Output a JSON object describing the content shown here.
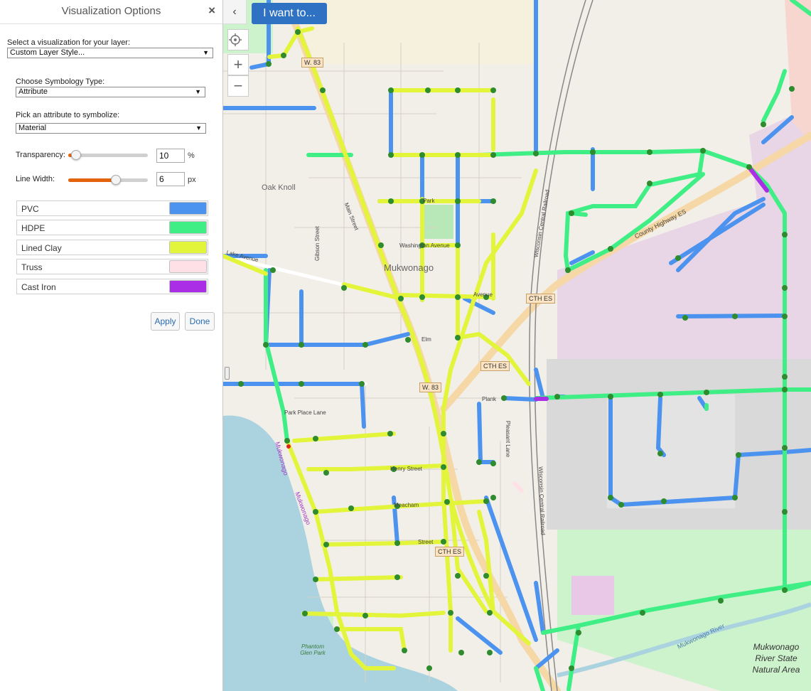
{
  "panel": {
    "title": "Visualization Options",
    "close_symbol": "×",
    "visualization_label": "Select a visualization for your layer:",
    "visualization_value": "Custom Layer Style...",
    "symbology_label": "Choose Symbology Type:",
    "symbology_value": "Attribute",
    "attribute_label": "Pick an attribute to symbolize:",
    "attribute_value": "Material",
    "transparency": {
      "label": "Transparency:",
      "value": "10",
      "unit": "%",
      "fraction": 0.1
    },
    "line_width": {
      "label": "Line Width:",
      "value": "6",
      "unit": "px",
      "fraction": 0.6
    },
    "legend": [
      {
        "label": "PVC",
        "color": "#4b93ee"
      },
      {
        "label": "HDPE",
        "color": "#3fee84"
      },
      {
        "label": "Lined Clay",
        "color": "#e3f53a"
      },
      {
        "label": "Truss",
        "color": "#ffe0e6"
      },
      {
        "label": "Cast Iron",
        "color": "#aa2ee6"
      }
    ],
    "apply_label": "Apply",
    "done_label": "Done"
  },
  "map": {
    "i_want_label": "I want to...",
    "collapse_symbol": "‹",
    "zoom_in_symbol": "+",
    "zoom_out_symbol": "−",
    "labels": {
      "w83_top": "W. 83",
      "oak_knoll": "Oak Knoll",
      "mukwonago": "Mukwonago",
      "washington_avenue": "Washington Avenue",
      "gibson_street": "Gibson Street",
      "county_highway": "County Highway ES",
      "cth_es_1": "CTH ES",
      "cth_es_2": "CTH ES",
      "cth_es_3": "CTH ES",
      "w83_mid": "W. 83",
      "plank": "Plank",
      "park_place_lane": "Park Place Lane",
      "pleasant_lane": "Pleasant Lane",
      "wisconsin_central_rr_1": "Wisconsin Central Railroad",
      "wisconsin_central_rr_2": "Wisconsin Central Railroad",
      "henry_street": "Henry Street",
      "meacham": "Meacham",
      "street": "Street",
      "mukwonago_river": "Mukwonago River",
      "phantom_glen_park": "Phantom Glen Park",
      "state_natural_area": "Mukwonago River State Natural Area",
      "lake_avenue": "Lake Avenue",
      "avenue": "Avenue",
      "elm": "Elm",
      "park": "Park",
      "mukwonago_lake": "Mukwonago",
      "main": "Main Street",
      "lake_label_2": "Mukwonago"
    },
    "colors": {
      "background": "#f2efe9",
      "water": "#aad3df",
      "park": "#cdf3cd",
      "commercial": "#e8d6e6",
      "industrial": "#d9d9d9",
      "road_major": "#f6d7a6",
      "node": "#2e8b2e"
    }
  }
}
